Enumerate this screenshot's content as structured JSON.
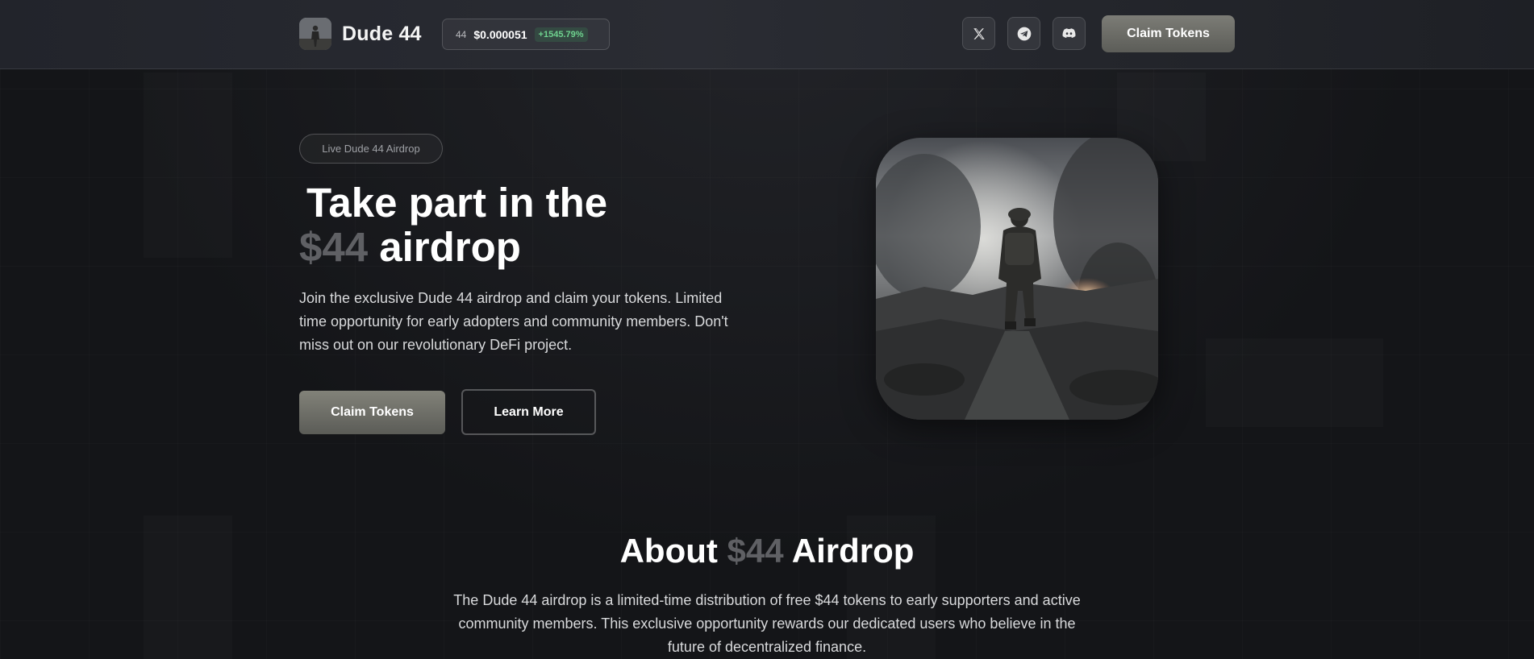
{
  "header": {
    "brand_name": "Dude 44",
    "ticker": {
      "symbol": "44",
      "price": "$0.000051",
      "change": "+1545.79%"
    },
    "social": [
      {
        "name": "x",
        "icon": "x-icon"
      },
      {
        "name": "telegram",
        "icon": "telegram-icon"
      },
      {
        "name": "discord",
        "icon": "discord-icon"
      }
    ],
    "claim_label": "Claim Tokens"
  },
  "hero": {
    "badge": "Live Dude 44 Airdrop",
    "title_line1": "Take part in the",
    "title_highlight": "$44",
    "title_rest": " airdrop",
    "description": "Join the exclusive Dude 44 airdrop and claim your tokens. Limited time opportunity for early adopters and community members. Don't miss out on our revolutionary DeFi project.",
    "primary_button": "Claim Tokens",
    "secondary_button": "Learn More"
  },
  "about": {
    "title_pre": "About ",
    "title_highlight": "$44",
    "title_post": " Airdrop",
    "description": "The Dude 44 airdrop is a limited-time distribution of free $44 tokens to early supporters and active community members. This exclusive opportunity rewards our dedicated users who believe in the future of decentralized finance."
  },
  "colors": {
    "background": "#141518",
    "accent_button": "#6e6e68",
    "highlight_text": "#5f6064",
    "positive": "#6fd38f"
  }
}
